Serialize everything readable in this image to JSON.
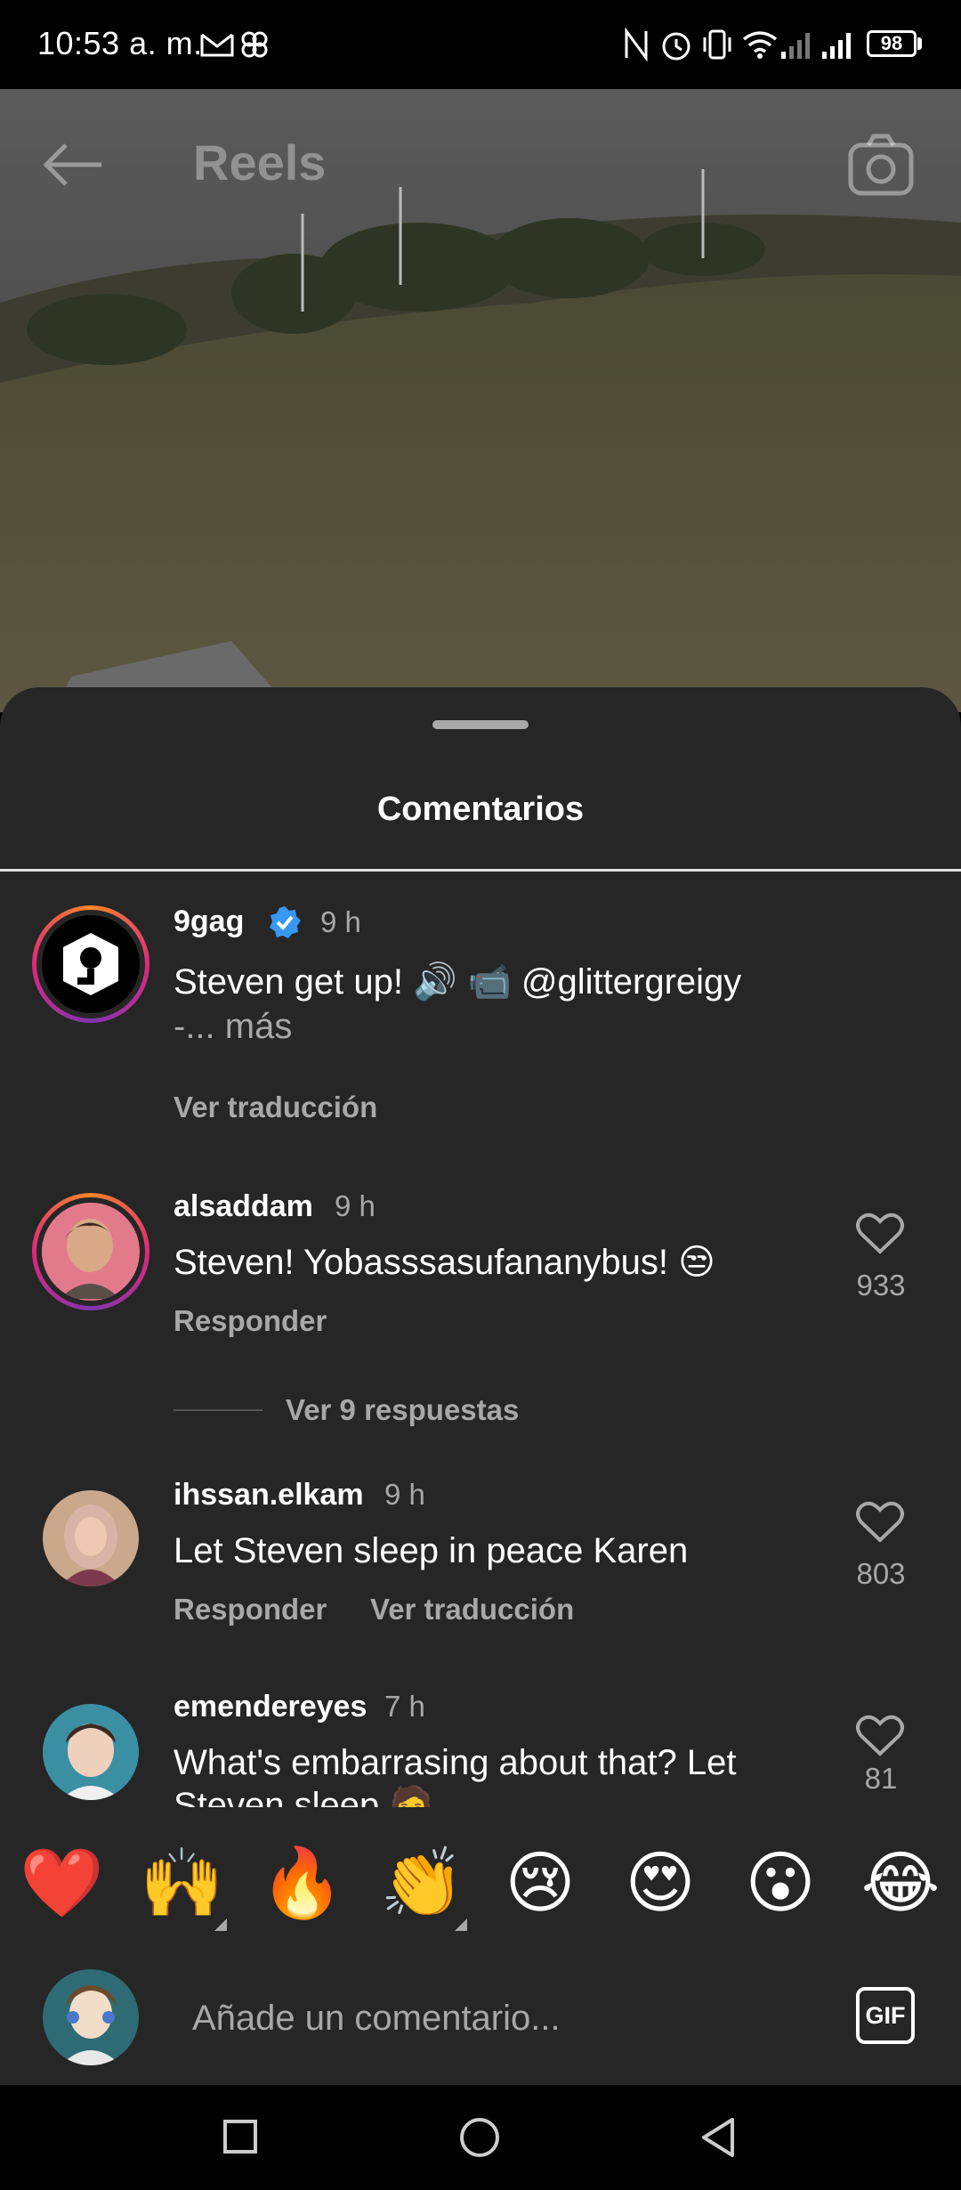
{
  "status_bar": {
    "time": "10:53 a. m.",
    "battery": "98",
    "icons": [
      "gmail-icon",
      "pinwheel-icon",
      "nfc-icon",
      "alarm-icon",
      "vibrate-icon",
      "wifi-icon",
      "signal-icon",
      "signal-icon-2",
      "battery-icon"
    ]
  },
  "header": {
    "title": "Reels",
    "back_icon": "arrow-left-icon",
    "camera_icon": "camera-icon"
  },
  "comments_sheet": {
    "title": "Comentarios",
    "caption": {
      "username": "9gag",
      "verified": true,
      "time": "9 h",
      "text_line1": "Steven get up! 🔊 📹 @glittergreigy",
      "text_line2": "-... más",
      "see_translation": "Ver traducción"
    },
    "comments": [
      {
        "username": "alsaddam",
        "time": "9 h",
        "text": "Steven! Yobasssasufananybus! 😒",
        "reply": "Responder",
        "likes": "933",
        "view_replies": "Ver 9 respuestas"
      },
      {
        "username": "ihssan.elkam",
        "time": "9 h",
        "text": "Let Steven sleep in peace Karen",
        "reply": "Responder",
        "see_translation": "Ver traducción",
        "likes": "803"
      },
      {
        "username": "emendereyes",
        "time": "7 h",
        "text_line1": "What's embarrasing about that? Let",
        "text_line2": "Steven sleep 🧑",
        "likes": "81"
      }
    ]
  },
  "emoji_reactions": [
    "❤️",
    "🙌",
    "🔥",
    "👏",
    "😢",
    "😍",
    "😮",
    "😂"
  ],
  "comment_input": {
    "placeholder": "Añade un comentario...",
    "gif_label": "GIF"
  },
  "colors": {
    "sheet_bg": "#262626",
    "secondary_text": "#a8a8a8",
    "verified_blue": "#3897f0",
    "story_ring_start": "#f58529",
    "story_ring_end": "#dd2a7b"
  }
}
